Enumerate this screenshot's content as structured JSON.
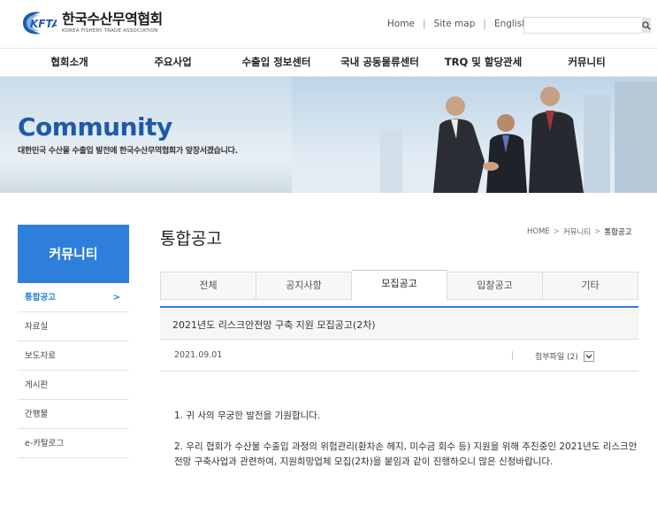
{
  "header": {
    "logo_title": "한국수산무역협회",
    "logo_sub": "KOREA FISHERY TRADE ASSOCIATION",
    "logo_mark": "KFTA",
    "links": [
      "Home",
      "Site map",
      "English"
    ],
    "search_placeholder": ""
  },
  "gnb": [
    "협회소개",
    "주요사업",
    "수출입 정보센터",
    "국내 공동물류센터",
    "TRQ 및 할당관세",
    "커뮤니티"
  ],
  "visual": {
    "title": "Community",
    "desc": "대한민국 수산물 수출입 발전에 한국수산무역협회가 앞장서겠습니다."
  },
  "lnb": {
    "head": "커뮤니티",
    "items": [
      {
        "label": "통합공고",
        "active": true,
        "arrow": ">"
      },
      {
        "label": "자료실"
      },
      {
        "label": "보도자료"
      },
      {
        "label": "게시판"
      },
      {
        "label": "간행물"
      },
      {
        "label": "e-카탈로그"
      }
    ]
  },
  "page": {
    "title": "통합공고",
    "breadcrumb": [
      "HOME",
      "커뮤니티",
      "통합공고"
    ],
    "tabs": [
      "전체",
      "공지사항",
      "모집공고",
      "입찰공고",
      "기타"
    ],
    "active_tab": 2
  },
  "post": {
    "title": "2021년도 리스크안전망 구축 지원 모집공고(2차)",
    "date": "2021.09.01",
    "attach_label": "첨부파일 (2)",
    "paragraphs": [
      "1. 귀 사의 무궁한 발전을 기원합니다.",
      "2. 우리 협회가  수산물 수출입 과정의 위험관리(환차손 헤지, 미수금 회수 등) 지원을 위해  추진중인 2021년도 리스크안전망 구축사업과 관련하여, 지원희망업체 모집(2차)을 붙임과 같이 진행하오니 많은 신청바랍니다."
    ]
  },
  "colors": {
    "brand_blue": "#2e7fdb",
    "visual_title": "#1f5aa8"
  }
}
